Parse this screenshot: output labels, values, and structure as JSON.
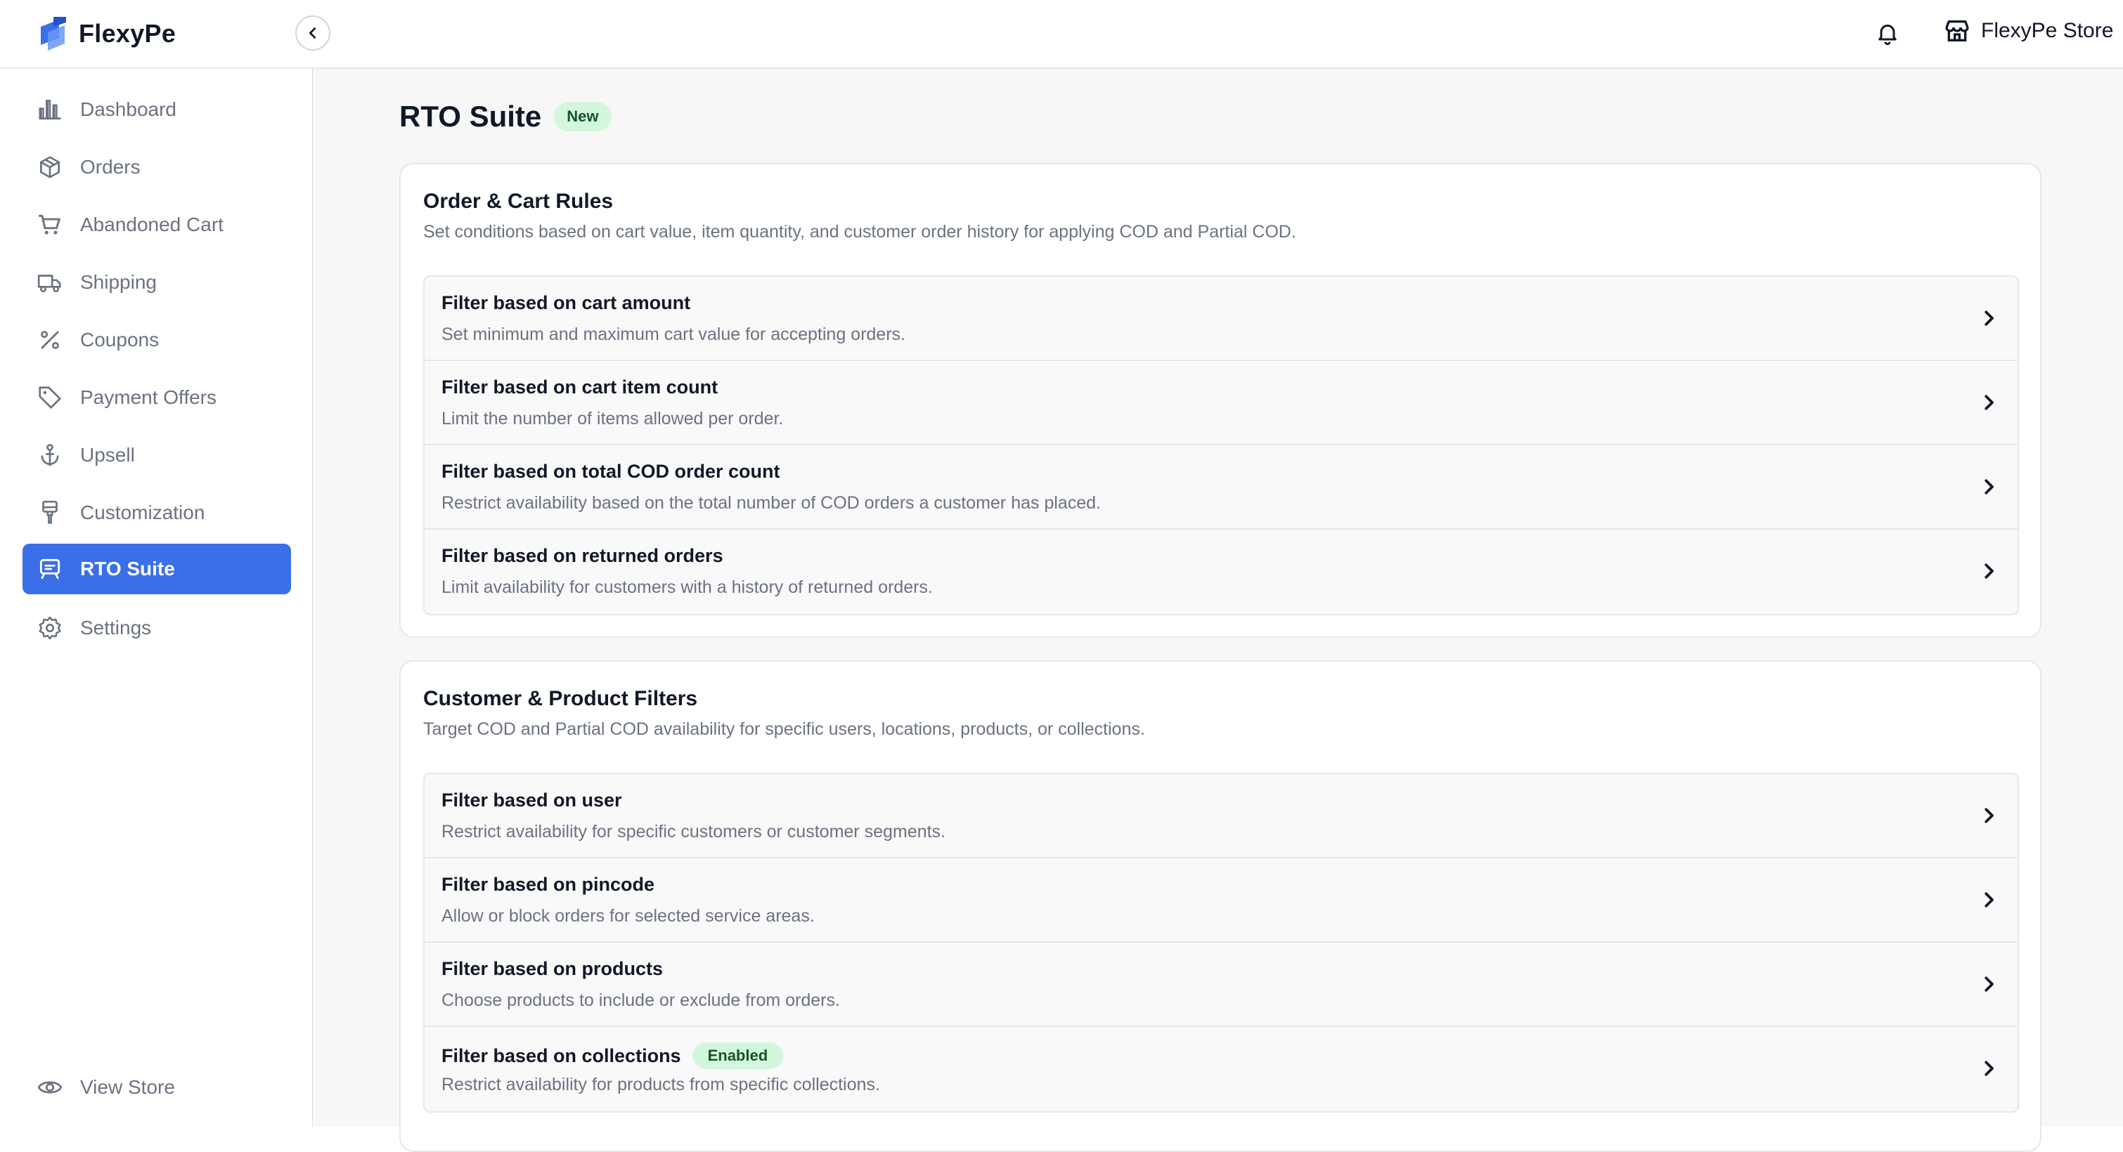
{
  "brand": {
    "name": "FlexyPe"
  },
  "header": {
    "store_name": "FlexyPe Store"
  },
  "sidebar": {
    "items": [
      {
        "label": "Dashboard",
        "icon": "bar-chart-icon"
      },
      {
        "label": "Orders",
        "icon": "box-icon"
      },
      {
        "label": "Abandoned Cart",
        "icon": "cart-icon"
      },
      {
        "label": "Shipping",
        "icon": "truck-icon"
      },
      {
        "label": "Coupons",
        "icon": "percent-icon"
      },
      {
        "label": "Payment Offers",
        "icon": "tag-icon"
      },
      {
        "label": "Upsell",
        "icon": "anchor-icon"
      },
      {
        "label": "Customization",
        "icon": "paint-brush-icon"
      },
      {
        "label": "RTO Suite",
        "icon": "rto-icon",
        "active": true
      },
      {
        "label": "Settings",
        "icon": "gear-icon"
      }
    ],
    "footer_label": "View Store"
  },
  "page": {
    "title": "RTO Suite",
    "badge": "New"
  },
  "sections": [
    {
      "title": "Order & Cart Rules",
      "subtitle": "Set conditions based on cart value, item quantity, and customer order history for applying COD and Partial COD.",
      "rows": [
        {
          "title": "Filter based on cart amount",
          "desc": "Set minimum and maximum cart value for accepting orders."
        },
        {
          "title": "Filter based on cart item count",
          "desc": "Limit the number of items allowed per order."
        },
        {
          "title": "Filter based on total COD order count",
          "desc": "Restrict availability based on the total number of COD orders a customer has placed."
        },
        {
          "title": "Filter based on returned orders",
          "desc": "Limit availability for customers with a history of returned orders."
        }
      ]
    },
    {
      "title": "Customer & Product Filters",
      "subtitle": "Target COD and Partial COD availability for specific users, locations, products, or collections.",
      "rows": [
        {
          "title": "Filter based on user",
          "desc": "Restrict availability for specific customers or customer segments."
        },
        {
          "title": "Filter based on pincode",
          "desc": "Allow or block orders for selected service areas."
        },
        {
          "title": "Filter based on products",
          "desc": "Choose products to include or exclude from orders."
        },
        {
          "title": "Filter based on collections",
          "desc": "Restrict availability for products from specific collections.",
          "badge": "Enabled"
        }
      ]
    }
  ],
  "colors": {
    "accent": "#3b6fe8",
    "badge_bg": "#d3f7dd",
    "badge_text": "#14532d"
  }
}
